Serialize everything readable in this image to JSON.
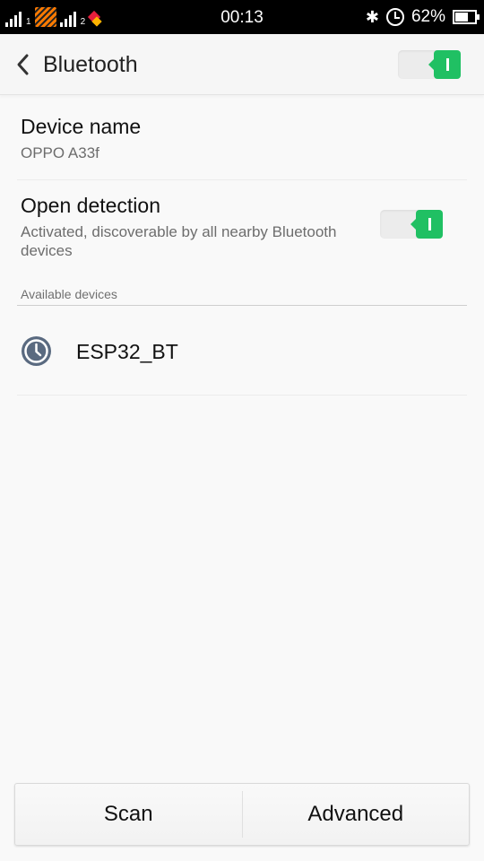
{
  "status_bar": {
    "sim1_label": "1",
    "sim2_label": "2",
    "time": "00:13",
    "bluetooth_icon": "bluetooth-icon",
    "alarm_icon": "alarm-icon",
    "battery_text": "62%",
    "battery_level": 0.62
  },
  "header": {
    "back_icon": "chevron-left-icon",
    "title": "Bluetooth",
    "bluetooth_toggle_on": true
  },
  "settings": {
    "device_name": {
      "title": "Device name",
      "value": "OPPO A33f"
    },
    "open_detection": {
      "title": "Open detection",
      "subtitle": "Activated, discoverable by all nearby Bluetooth devices",
      "enabled": true
    }
  },
  "available_devices": {
    "label": "Available devices",
    "devices": [
      {
        "name": "ESP32_BT",
        "icon": "clock-icon"
      }
    ]
  },
  "bottom_actions": {
    "scan_label": "Scan",
    "advanced_label": "Advanced"
  },
  "colors": {
    "accent_green": "#20c063",
    "icon_slate": "#5a6a80"
  }
}
